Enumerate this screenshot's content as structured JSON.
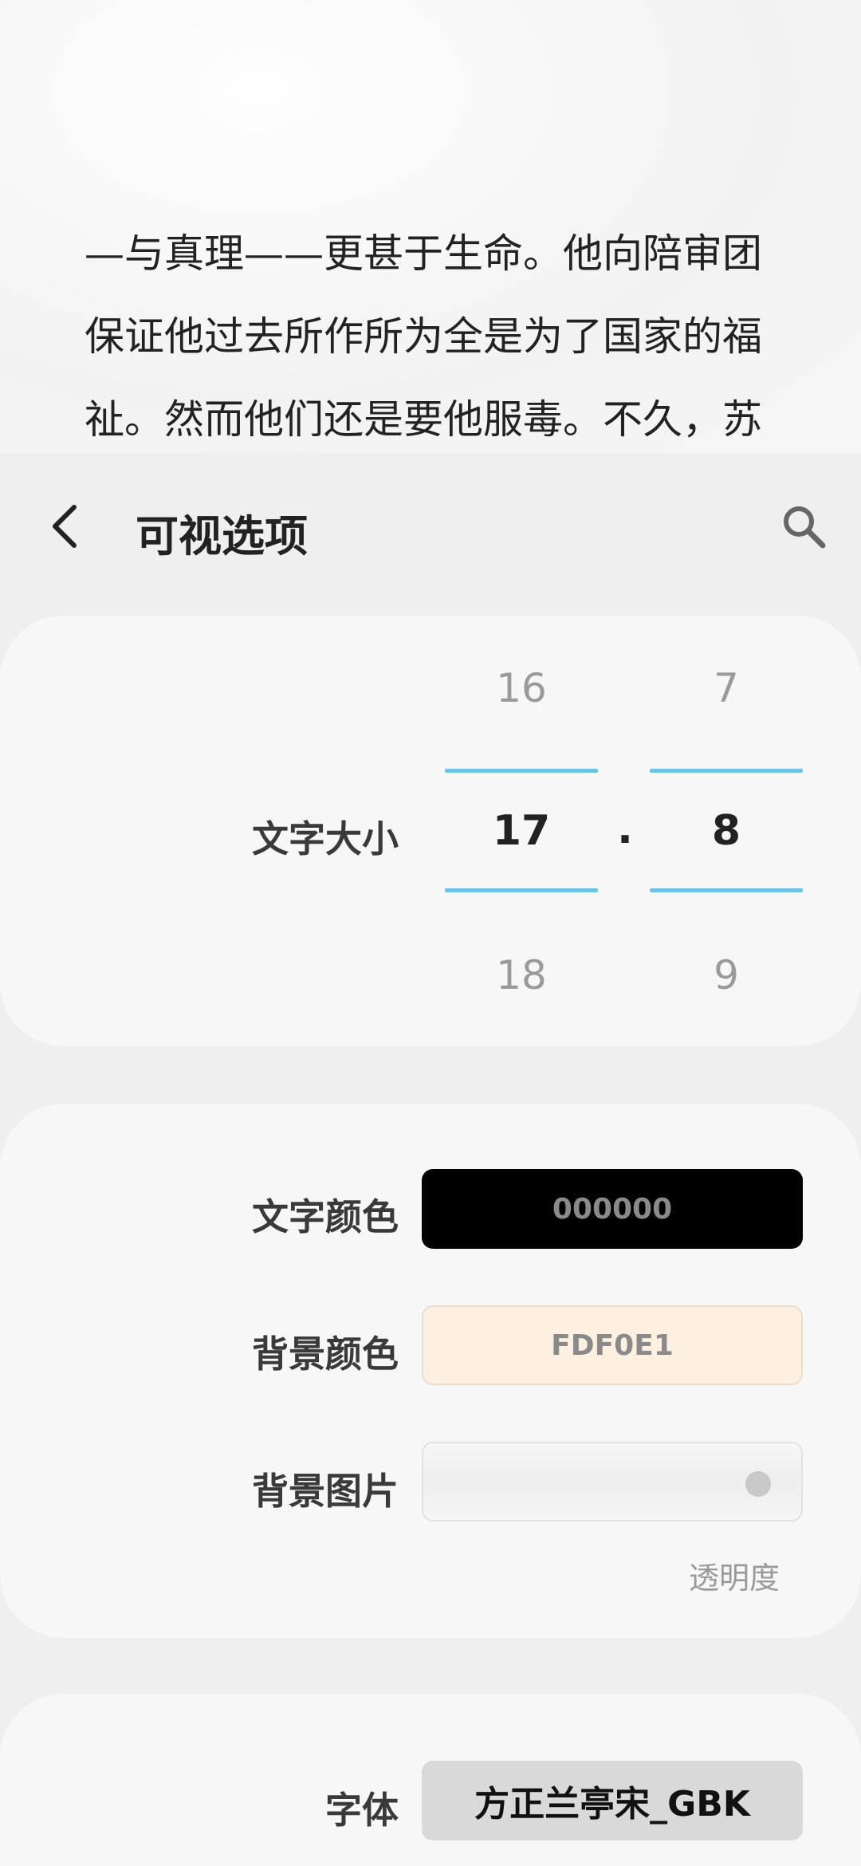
{
  "preview": {
    "lines": [
      "—与真理——更甚于生命。他向陪审团",
      "保证他过去所作所为全是为了国家的福",
      "祉。然而他们还是要他服毒。不久，苏"
    ]
  },
  "header": {
    "title": "可视选项",
    "back_icon": "chevron-left-icon",
    "search_icon": "search-icon"
  },
  "font_size": {
    "label": "文字大小",
    "integer": {
      "above": "16",
      "selected": "17",
      "below": "18"
    },
    "separator": ".",
    "decimal": {
      "above": "7",
      "selected": "8",
      "below": "9"
    }
  },
  "colors": {
    "text_color_label": "文字颜色",
    "text_color_value": "000000",
    "text_color_hex": "#000000",
    "bg_color_label": "背景颜色",
    "bg_color_value": "FDF0E1",
    "bg_color_hex": "#FDF0E1",
    "bg_image_label": "背景图片",
    "opacity_label": "透明度",
    "accent": "#6CC3E3"
  },
  "font": {
    "label": "字体",
    "value": "方正兰亭宋_GBK"
  }
}
